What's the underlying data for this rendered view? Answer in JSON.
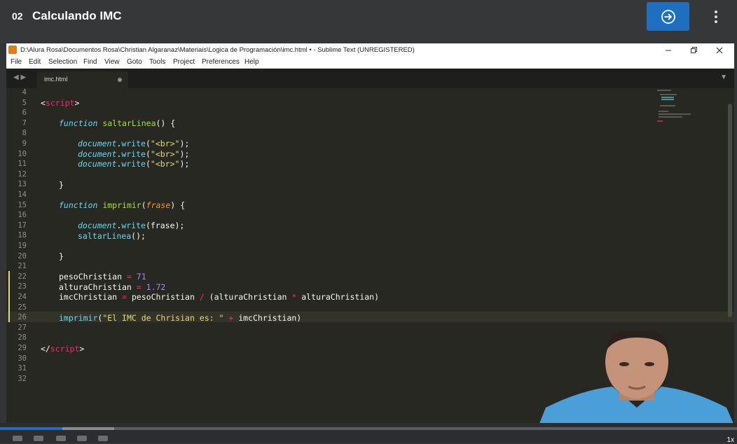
{
  "course": {
    "number": "02",
    "title": "Calculando IMC"
  },
  "colors": {
    "accent": "#1f6fc1",
    "editor_bg": "#272822",
    "keyword": "#66d9ef",
    "function": "#a6e22e",
    "string": "#e6db74",
    "number": "#ae81ff",
    "tag": "#f92672"
  },
  "window": {
    "title": "D:\\Alura Rosa\\Documentos Rosa\\Christian Algaranaz\\Materiais\\Logica de Programación\\imc.html • - Sublime Text (UNREGISTERED)"
  },
  "menu": [
    "File",
    "Edit",
    "Selection",
    "Find",
    "View",
    "Goto",
    "Tools",
    "Project",
    "Preferences",
    "Help"
  ],
  "tab": {
    "label": "imc.html"
  },
  "line_numbers": [
    "4",
    "5",
    "6",
    "7",
    "8",
    "9",
    "10",
    "11",
    "12",
    "13",
    "14",
    "15",
    "16",
    "17",
    "18",
    "19",
    "20",
    "21",
    "22",
    "23",
    "24",
    "25",
    "26",
    "27",
    "28",
    "29",
    "30",
    "31",
    "32"
  ],
  "code": {
    "l5_open": "<",
    "l5_tag": "script",
    "l5_close": ">",
    "l7_kw": "function",
    "l7_name": "saltarLinea",
    "l7_rest": "() {",
    "l9_obj": "document",
    "l9_dot": ".",
    "l9_method": "write",
    "l9_p1": "(",
    "l9_str": "\"<br>\"",
    "l9_p2": ");",
    "l10_obj": "document",
    "l10_dot": ".",
    "l10_method": "write",
    "l10_p1": "(",
    "l10_str": "\"<br>\"",
    "l10_p2": ");",
    "l11_obj": "document",
    "l11_dot": ".",
    "l11_method": "write",
    "l11_p1": "(",
    "l11_str": "\"<br>\"",
    "l11_p2": ");",
    "l13": "}",
    "l15_kw": "function",
    "l15_name": "imprimir",
    "l15_p1": "(",
    "l15_param": "frase",
    "l15_p2": ") {",
    "l17_obj": "document",
    "l17_dot": ".",
    "l17_method": "write",
    "l17_rest": "(frase);",
    "l18_name": "saltarLinea",
    "l18_rest": "();",
    "l20": "}",
    "l22_var": "pesoChristian",
    "l22_eq": " = ",
    "l22_num": "71",
    "l23_var": "alturaChristian",
    "l23_eq": " = ",
    "l23_num": "1.72",
    "l24_var": "imcChristian",
    "l24_eq": " = ",
    "l24_a": "pesoChristian ",
    "l24_div": "/",
    "l24_b": " (alturaChristian ",
    "l24_mul": "*",
    "l24_c": " alturaChristian)",
    "l26_name": "imprimir",
    "l26_p1": "(",
    "l26_str": "\"El IMC de Chrisian es: \"",
    "l26_plus": " + ",
    "l26_rest": "imcChristian)",
    "l29_open": "</",
    "l29_tag": "script",
    "l29_close": ">"
  },
  "player": {
    "progress": 0.085,
    "buffered": 0.155,
    "speed": "1x"
  }
}
